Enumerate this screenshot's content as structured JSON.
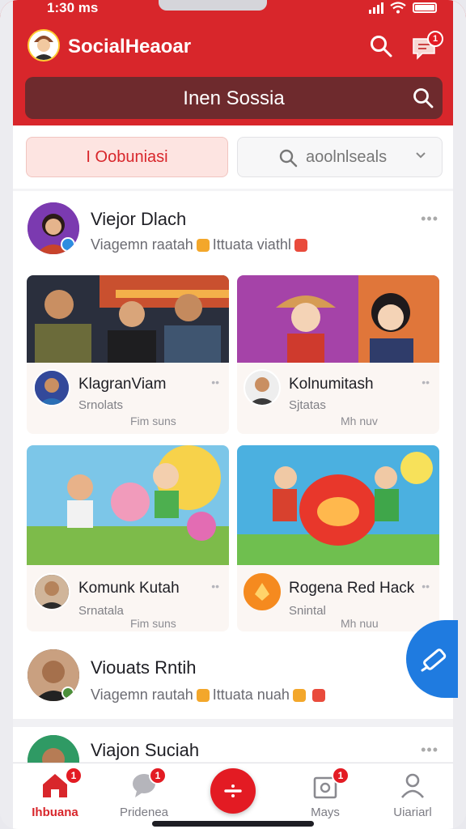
{
  "status_bar": {
    "time": "1:30 ms"
  },
  "header": {
    "app_name": "SocialHeaoar",
    "search_text": "Inen Sossia",
    "chat_badge": "1"
  },
  "filters": {
    "primary_chip": "I Oobuniasi",
    "dropdown_label": "aoolnlseals"
  },
  "posts": [
    {
      "name": "Viejor Dlach",
      "subtitle_a": "Viagemn raatah",
      "subtitle_b": "Ittuata viathl",
      "more": "•••"
    },
    {
      "name": "Viouats Rntih",
      "subtitle_a": "Viagemn rautah",
      "subtitle_b": "Ittuata nuah",
      "more": ""
    },
    {
      "name": "Viajon Suciah",
      "more": "•••"
    }
  ],
  "cards": [
    {
      "title": "KlagranViam",
      "sub": "Srnolats",
      "meta": "Fim suns",
      "more": "••"
    },
    {
      "title": "Kolnumitash",
      "sub": "Sjtatas",
      "meta": "Mh nuv",
      "more": "••"
    },
    {
      "title": "Komunk Kutah",
      "sub": "Srnatala",
      "meta": "Fim suns",
      "more": "••"
    },
    {
      "title": "Rogena Red Hack",
      "sub": "Snintal",
      "meta": "Mh nuu",
      "more": "••"
    }
  ],
  "bottom_nav": [
    {
      "label": "Ihbuana",
      "badge": "1"
    },
    {
      "label": "Pridenea",
      "badge": "1"
    },
    {
      "label": "Mays",
      "badge": "1"
    },
    {
      "label": "Uiariarl",
      "badge": ""
    }
  ],
  "colors": {
    "brand_red": "#d8262b",
    "search_bg": "#6e2a2d",
    "fab_blue": "#1f7be0"
  }
}
